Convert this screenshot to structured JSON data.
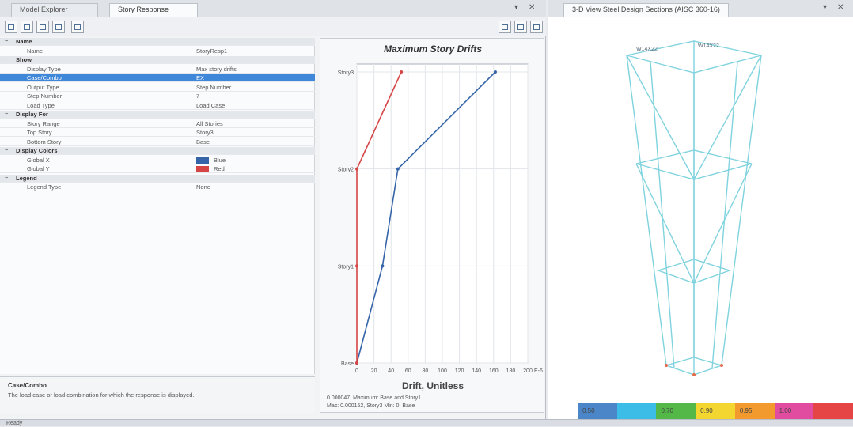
{
  "tabs": {
    "model_explorer": "Model Explorer",
    "story_response": "Story Response"
  },
  "properties": {
    "rows": [
      {
        "type": "cat",
        "key": "Name"
      },
      {
        "type": "row",
        "key": "Name",
        "value": "StoryResp1"
      },
      {
        "type": "cat",
        "key": "Show"
      },
      {
        "type": "row",
        "key": "Display Type",
        "value": "Max story drifts"
      },
      {
        "type": "row",
        "key": "Case/Combo",
        "value": "EX",
        "selected": true
      },
      {
        "type": "row",
        "key": "Output Type",
        "value": "Step Number"
      },
      {
        "type": "row",
        "key": "Step Number",
        "value": "7"
      },
      {
        "type": "row",
        "key": "Load Type",
        "value": "Load Case"
      },
      {
        "type": "cat",
        "key": "Display For"
      },
      {
        "type": "row",
        "key": "Story Range",
        "value": "All Stories"
      },
      {
        "type": "row",
        "key": "Top Story",
        "value": "Story3"
      },
      {
        "type": "row",
        "key": "Bottom Story",
        "value": "Base"
      },
      {
        "type": "cat",
        "key": "Display Colors"
      },
      {
        "type": "row",
        "key": "Global X",
        "value": "Blue",
        "swatch": "#3565a8"
      },
      {
        "type": "row",
        "key": "Global Y",
        "value": "Red",
        "swatch": "#d64545"
      },
      {
        "type": "cat",
        "key": "Legend"
      },
      {
        "type": "row",
        "key": "Legend Type",
        "value": "None"
      }
    ]
  },
  "description": {
    "title": "Case/Combo",
    "text": "The load case or load combination for which the response is displayed."
  },
  "chart_data": {
    "type": "line",
    "title": "Maximum Story Drifts",
    "xlabel": "Drift, Unitless",
    "ylabel": "",
    "categories": [
      "Base",
      "Story1",
      "Story2",
      "Story3"
    ],
    "xticks": [
      "0",
      "20",
      "40",
      "60",
      "80",
      "100",
      "120",
      "140",
      "160",
      "180",
      "200",
      "E-6"
    ],
    "xlim": [
      0,
      200
    ],
    "grid": true,
    "series": [
      {
        "color": "#3565a8",
        "x": [
          0,
          30,
          48,
          162
        ]
      },
      {
        "color": "#d64545",
        "x": [
          0,
          0,
          0,
          52
        ]
      }
    ]
  },
  "chart_status": {
    "line1": "0.000047, Maximum: Base and Story1",
    "line2": "Max: 0.000152, Story3    Min: 0, Base"
  },
  "view3d": {
    "title": "3-D View  Steel Design Sections (AISC 360-16)"
  },
  "legend_bar": [
    {
      "label": "0.50",
      "color": "#4a86c8"
    },
    {
      "label": "",
      "color": "#3cbde8"
    },
    {
      "label": "0.70",
      "color": "#53b848"
    },
    {
      "label": "0.90",
      "color": "#f3d62f"
    },
    {
      "label": "0.95",
      "color": "#f29a2e"
    },
    {
      "label": "1.00",
      "color": "#e14ca0"
    },
    {
      "label": "",
      "color": "#e54545"
    }
  ],
  "statusbar": "Ready"
}
